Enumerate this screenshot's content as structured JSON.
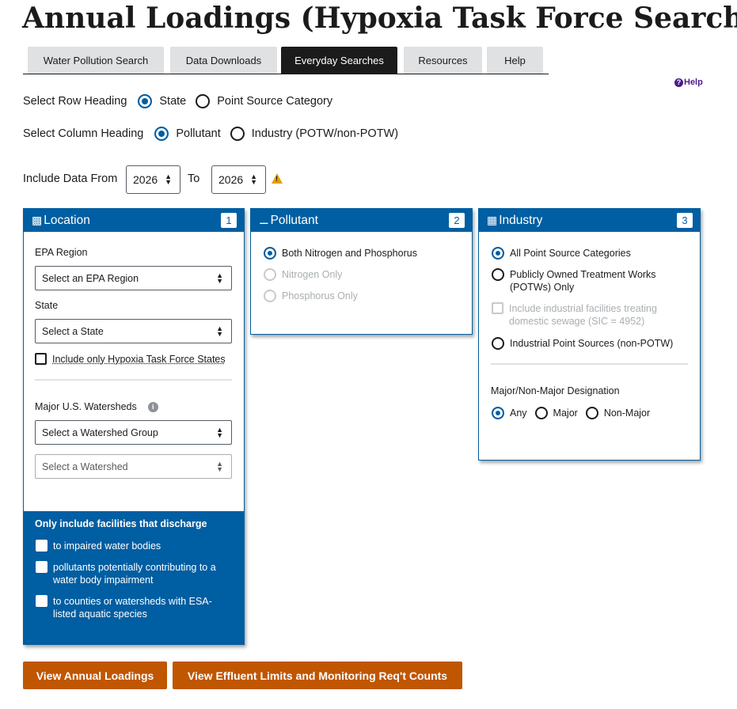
{
  "page_title": "Annual Loadings (Hypoxia Task Force Search)",
  "tabs": [
    {
      "label": "Water Pollution Search"
    },
    {
      "label": "Data Downloads"
    },
    {
      "label": "Everyday Searches"
    },
    {
      "label": "Resources"
    },
    {
      "label": "Help"
    }
  ],
  "active_tab": "Everyday Searches",
  "help_link": "Help",
  "row_heading": {
    "label": "Select Row Heading",
    "options": [
      "State",
      "Point Source Category"
    ],
    "selected": "State"
  },
  "column_heading": {
    "label": "Select Column Heading",
    "options": [
      "Pollutant",
      "Industry (POTW/non-POTW)"
    ],
    "selected": "Pollutant"
  },
  "date_range": {
    "label": "Include Data From",
    "from": "2026",
    "to_label": "To",
    "to": "2026",
    "warning_icon": "warning-triangle-icon"
  },
  "location": {
    "title": "Location",
    "number": "1",
    "icon": "location-icon",
    "epa_region_label": "EPA Region",
    "epa_region_value": "Select an EPA Region",
    "state_label": "State",
    "state_value": "Select a State",
    "hypoxia_only": "Include only Hypoxia Task Force States",
    "watersheds_label": "Major U.S. Watersheds",
    "watershed_group_value": "Select a Watershed Group",
    "watershed_value": "Select a Watershed",
    "discharge": {
      "heading": "Only include facilities that discharge",
      "options": [
        "to impaired water bodies",
        "pollutants potentially contributing to a water body impairment",
        "to counties or watersheds with ESA-listed aquatic species"
      ]
    }
  },
  "pollutant": {
    "title": "Pollutant",
    "number": "2",
    "icon": "pollutant-icon",
    "options": [
      "Both Nitrogen and Phosphorus",
      "Nitrogen Only",
      "Phosphorus Only"
    ],
    "selected": "Both Nitrogen and Phosphorus"
  },
  "industry": {
    "title": "Industry",
    "number": "3",
    "icon": "industry-icon",
    "options": [
      "All Point Source Categories",
      "Publicly Owned Treatment Works (POTWs) Only",
      "Include industrial facilities treating domestic sewage (SIC = 4952)",
      "Industrial Point Sources (non-POTW)"
    ],
    "selected": "All Point Source Categories",
    "designation_label": "Major/Non-Major Designation",
    "designation_options": [
      "Any",
      "Major",
      "Non-Major"
    ],
    "designation_selected": "Any"
  },
  "buttons": {
    "view_annual": "View Annual Loadings",
    "view_effluent": "View Effluent Limits and Monitoring Req't Counts"
  },
  "colors": {
    "primary": "#005ea2",
    "action": "#c05600",
    "active_tab": "#1b1b1b",
    "tab": "#dfe1e2",
    "warning": "#e5a000"
  }
}
